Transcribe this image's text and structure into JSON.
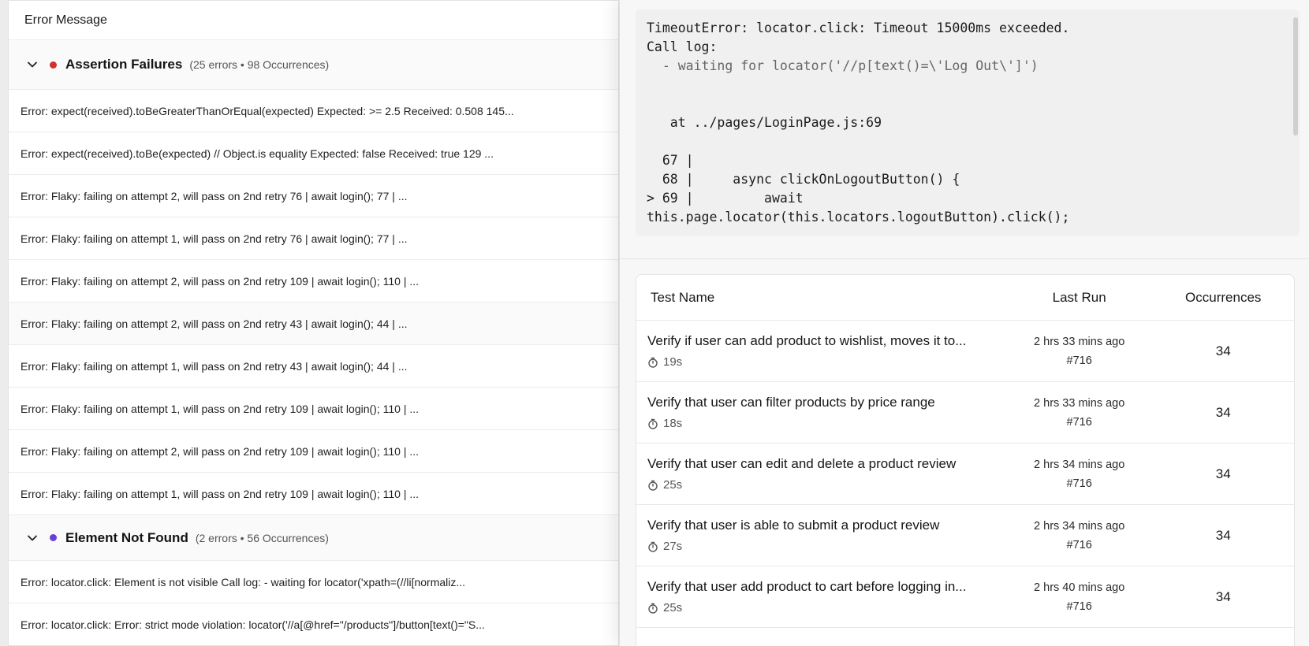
{
  "left": {
    "header": "Error Message",
    "groups": [
      {
        "title": "Assertion Failures",
        "meta": "(25 errors • 98 Occurrences)",
        "dot_color": "#d32f2f",
        "errors": [
          "Error: expect(received).toBeGreaterThanOrEqual(expected) Expected: >= 2.5 Received: 0.508 145...",
          "Error: expect(received).toBe(expected) // Object.is equality Expected: false Received: true 129 ...",
          "Error: Flaky: failing on attempt 2, will pass on 2nd retry 76 | await login(); 77 | ...",
          "Error: Flaky: failing on attempt 1, will pass on 2nd retry 76 | await login(); 77 | ...",
          "Error: Flaky: failing on attempt 2, will pass on 2nd retry 109 | await login(); 110 | ...",
          "Error: Flaky: failing on attempt 2, will pass on 2nd retry 43 | await login(); 44 | ...",
          "Error: Flaky: failing on attempt 1, will pass on 2nd retry 43 | await login(); 44 | ...",
          "Error: Flaky: failing on attempt 1, will pass on 2nd retry 109 | await login(); 110 | ...",
          "Error: Flaky: failing on attempt 2, will pass on 2nd retry 109 | await login(); 110 | ...",
          "Error: Flaky: failing on attempt 1, will pass on 2nd retry 109 | await login(); 110 | ..."
        ]
      },
      {
        "title": "Element Not Found",
        "meta": "(2 errors • 56 Occurrences)",
        "dot_color": "#6a3fd6",
        "errors": [
          "Error: locator.click: Element is not visible Call log: - waiting for locator('xpath=(//li[normaliz...",
          "Error: locator.click: Error: strict mode violation: locator('//a[@href=\"/products\"]/button[text()=\"S..."
        ]
      }
    ]
  },
  "right": {
    "code": {
      "line1": "TimeoutError: locator.click: Timeout 15000ms exceeded.",
      "line2": "Call log:",
      "line3": "  - waiting for locator('//p[text()=\\'Log Out\\']')",
      "line4": "   at ../pages/LoginPage.js:69",
      "line5": "  67 |",
      "line6": "  68 |     async clickOnLogoutButton() {",
      "line7": "> 69 |         await",
      "line8": "this.page.locator(this.locators.logoutButton).click();"
    },
    "table": {
      "col_name": "Test Name",
      "col_last": "Last Run",
      "col_occ": "Occurrences",
      "rows": [
        {
          "name": "Verify if user can add product to wishlist, moves it to...",
          "duration": "19s",
          "last_run": "2 hrs 33 mins ago",
          "run_id": "#716",
          "occurrences": "34"
        },
        {
          "name": "Verify that user can filter products by price range",
          "duration": "18s",
          "last_run": "2 hrs 33 mins ago",
          "run_id": "#716",
          "occurrences": "34"
        },
        {
          "name": "Verify that user can edit and delete a product review",
          "duration": "25s",
          "last_run": "2 hrs 34 mins ago",
          "run_id": "#716",
          "occurrences": "34"
        },
        {
          "name": "Verify that user is able to submit a product review",
          "duration": "27s",
          "last_run": "2 hrs 34 mins ago",
          "run_id": "#716",
          "occurrences": "34"
        },
        {
          "name": "Verify that user add product to cart before logging in...",
          "duration": "25s",
          "last_run": "2 hrs 40 mins ago",
          "run_id": "#716",
          "occurrences": "34"
        }
      ]
    }
  }
}
